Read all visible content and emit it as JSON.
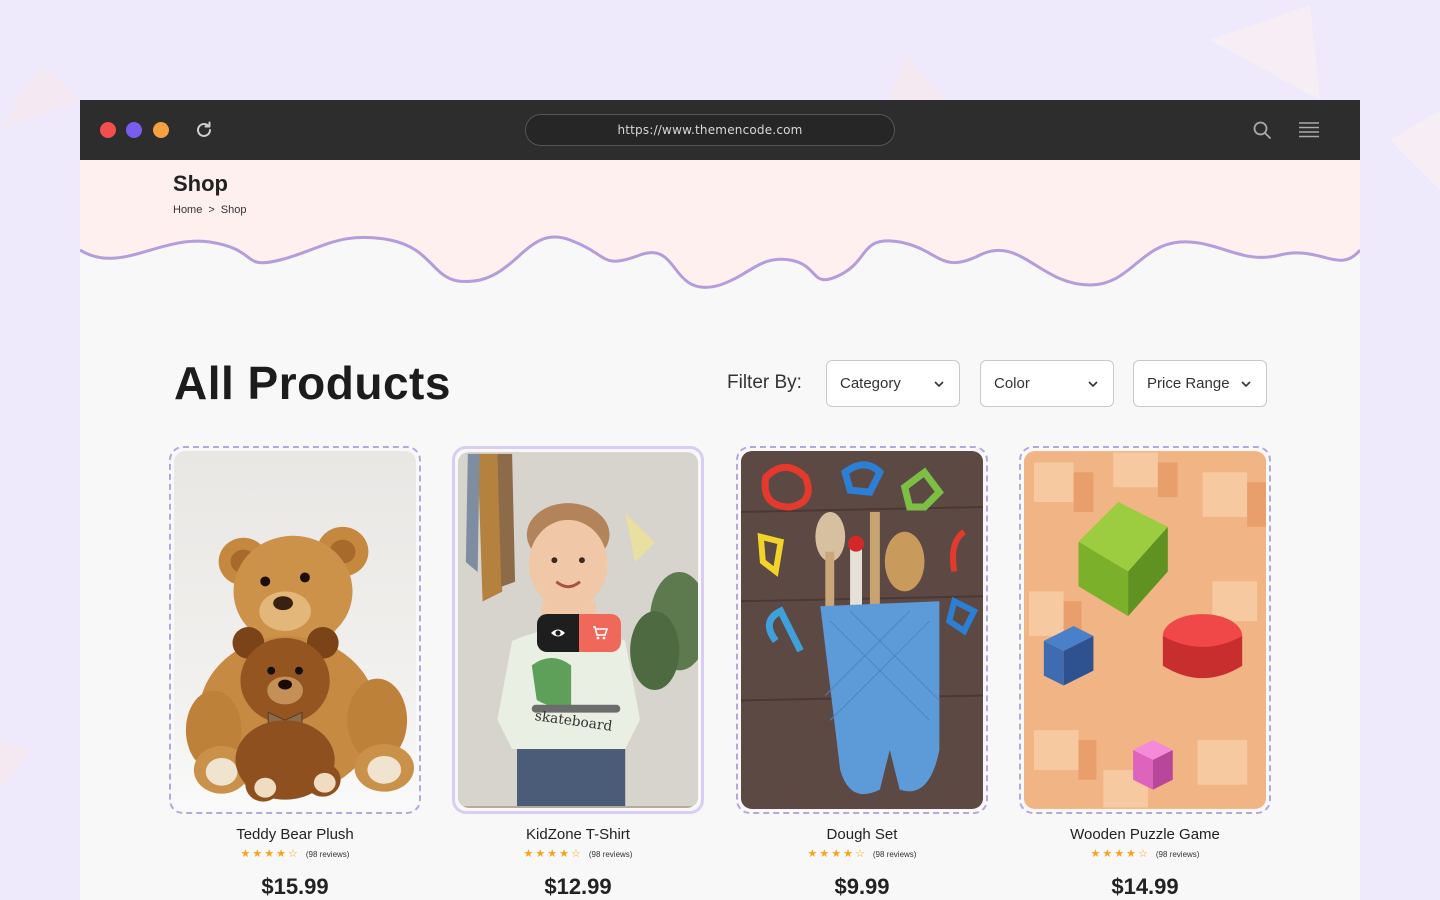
{
  "browser": {
    "url": "https://www.themencode.com"
  },
  "hero": {
    "title": "Shop",
    "breadcrumb": {
      "home": "Home",
      "separator": ">",
      "current": "Shop"
    }
  },
  "section": {
    "title": "All Products"
  },
  "filters": {
    "label": "Filter By:",
    "category": "Category",
    "color": "Color",
    "price_range": "Price Range"
  },
  "products": [
    {
      "name": "Teddy Bear Plush",
      "rating": 4,
      "reviews": "(98 reviews)",
      "price": "$15.99"
    },
    {
      "name": "KidZone T-Shirt",
      "rating": 4,
      "reviews": "(98 reviews)",
      "price": "$12.99"
    },
    {
      "name": "Dough Set",
      "rating": 4,
      "reviews": "(98 reviews)",
      "price": "$9.99"
    },
    {
      "name": "Wooden Puzzle Game",
      "rating": 4,
      "reviews": "(98 reviews)",
      "price": "$14.99"
    }
  ],
  "colors": {
    "accent_purple": "#b39ddb",
    "cart_red": "#f0685a",
    "star": "#f5a41a",
    "hero_bg": "#fff0f0"
  }
}
